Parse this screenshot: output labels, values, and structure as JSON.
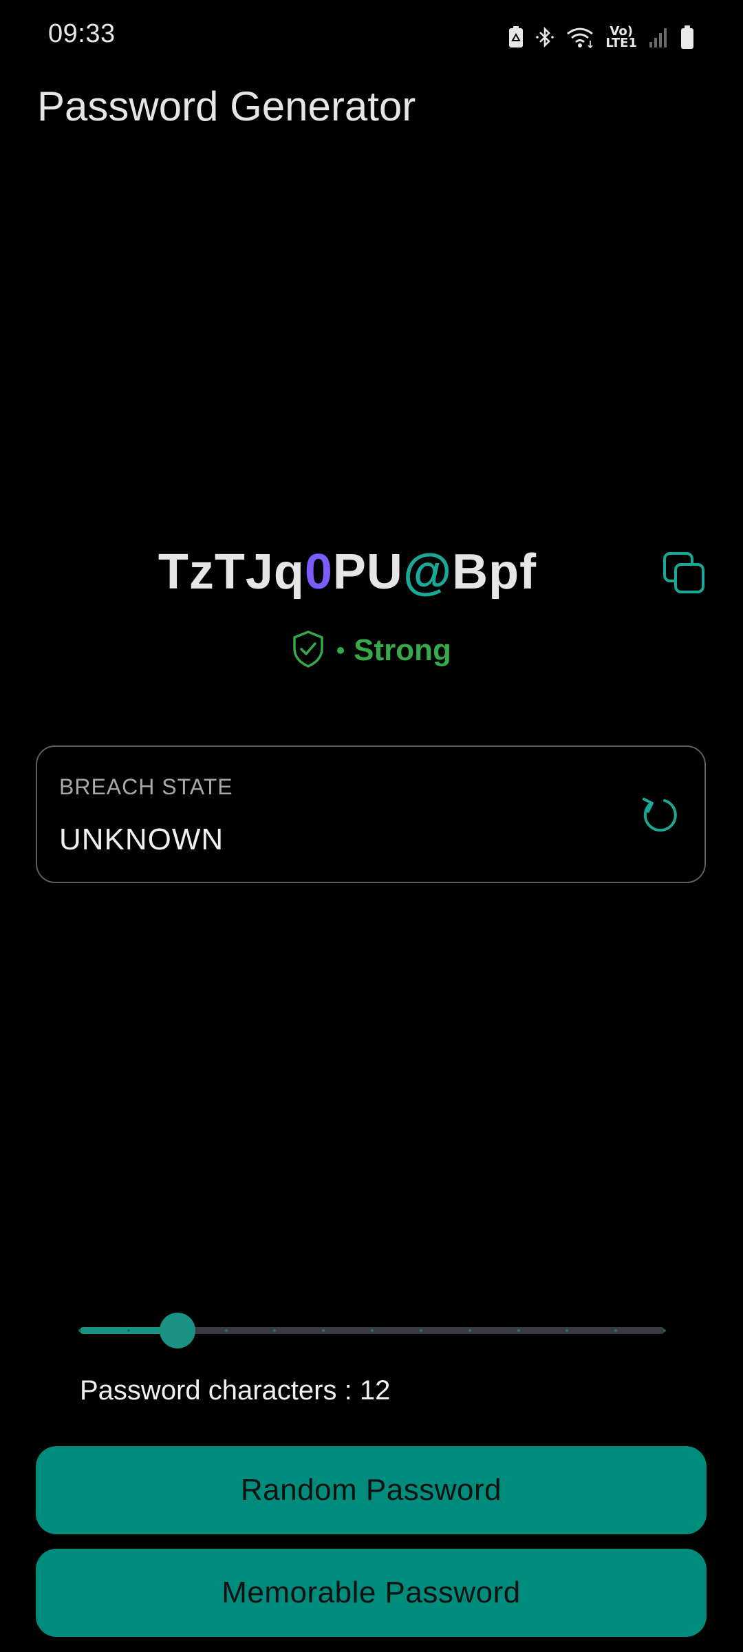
{
  "status_bar": {
    "time": "09:33",
    "icons": [
      "battery-saver-icon",
      "bluetooth-icon",
      "wifi-icon",
      "volte-lte1-icon",
      "signal-icon",
      "battery-icon"
    ],
    "lte_line1": "Vo)",
    "lte_line2": "LTE1"
  },
  "app": {
    "title": "Password Generator"
  },
  "password": {
    "segments": [
      {
        "text": "TzTJq",
        "kind": "letters"
      },
      {
        "text": "0",
        "kind": "digit"
      },
      {
        "text": "PU",
        "kind": "letters"
      },
      {
        "text": "@",
        "kind": "symbol"
      },
      {
        "text": "Bpf",
        "kind": "letters"
      }
    ],
    "copy_icon": "copy-icon"
  },
  "strength": {
    "icon": "shield-check-icon",
    "label": "Strong",
    "color": "#36a94a"
  },
  "breach": {
    "label": "BREACH STATE",
    "value": "UNKNOWN",
    "refresh_icon": "refresh-icon"
  },
  "slider": {
    "value": 12,
    "min": 8,
    "max": 32,
    "step": 2,
    "accent": "#1a9386"
  },
  "length_label": "Password characters : 12",
  "buttons": {
    "random": "Random Password",
    "memorable": "Memorable Password"
  },
  "colors": {
    "accent": "#008c7c",
    "digit": "#7c5cff",
    "symbol": "#1aa899",
    "background": "#000000"
  }
}
